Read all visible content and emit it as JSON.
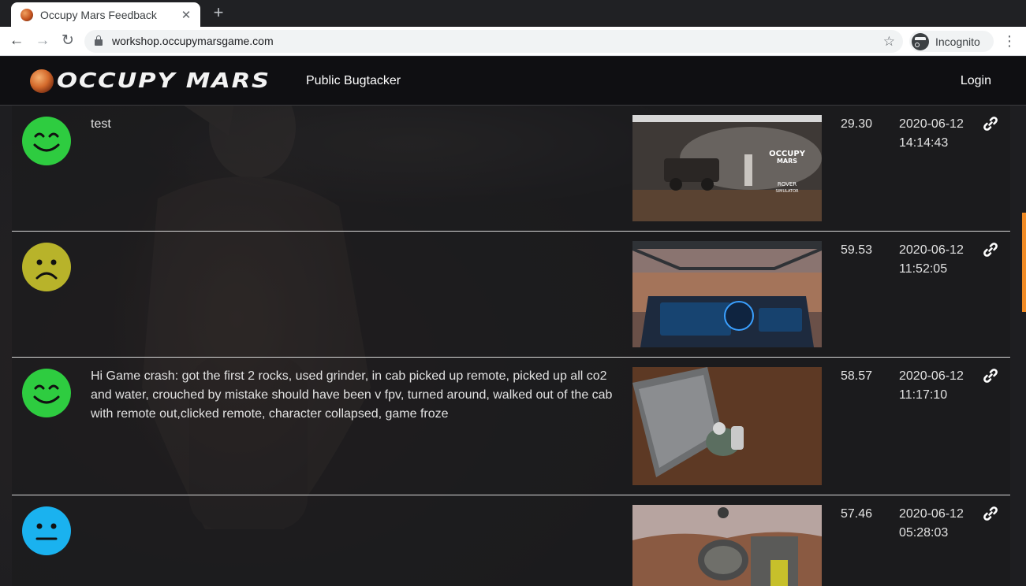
{
  "browser": {
    "tab_title": "Occupy Mars Feedback",
    "tab_close": "✕",
    "new_tab": "+",
    "url": "workshop.occupymarsgame.com",
    "profile_label": "Incognito"
  },
  "site": {
    "logo_text": "OCCUPY MARS",
    "nav_title": "Public Bugtacker",
    "login_label": "Login"
  },
  "entries": [
    {
      "mood": "happy",
      "mood_color": "#2ecc40",
      "comment": "test",
      "score": "29.30",
      "date": "2020-06-12",
      "time": "14:14:43"
    },
    {
      "mood": "sad",
      "mood_color": "#b8b32a",
      "comment": "",
      "score": "59.53",
      "date": "2020-06-12",
      "time": "11:52:05"
    },
    {
      "mood": "happy",
      "mood_color": "#2ecc40",
      "comment": "Hi Game crash: got the first 2 rocks, used grinder, in cab picked up remote, picked up all co2 and water, crouched by mistake should have been v fpv, turned around, walked out of the cab with remote out,clicked remote, character collapsed, game froze",
      "score": "58.57",
      "date": "2020-06-12",
      "time": "11:17:10"
    },
    {
      "mood": "neutral",
      "mood_color": "#1ab2ef",
      "comment": "",
      "score": "57.46",
      "date": "2020-06-12",
      "time": "05:28:03"
    }
  ],
  "screenshot_text": {
    "logo_line1": "OCCUPY",
    "logo_line2": "MARS",
    "rover_line1": "ROVER",
    "rover_line2": "SIMULATOR"
  }
}
